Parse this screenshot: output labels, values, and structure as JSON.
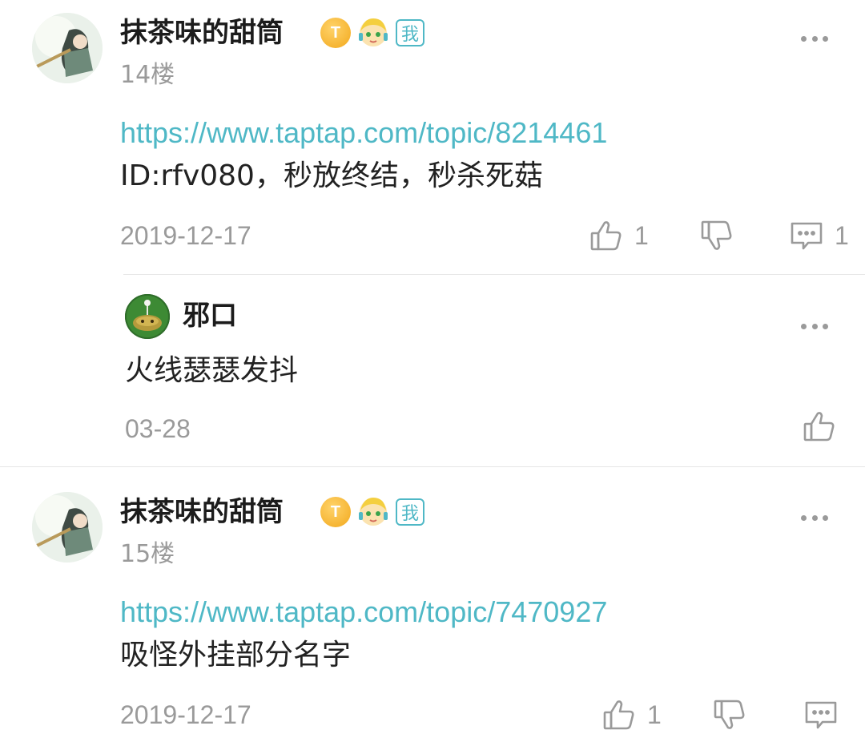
{
  "posts": [
    {
      "username": "抹茶味的甜筒",
      "level_badge": "T",
      "me_badge": "我",
      "floor": "14楼",
      "link": "https://www.taptap.com/topic/8214461",
      "text": "ID:rfv080，秒放终结，秒杀死菇",
      "date": "2019-12-17",
      "likes": "1",
      "comments": "1",
      "icons": [
        "more-icon",
        "thumbs-up-icon",
        "thumbs-down-icon",
        "comment-icon"
      ]
    },
    {
      "username": "抹茶味的甜筒",
      "level_badge": "T",
      "me_badge": "我",
      "floor": "15楼",
      "link": "https://www.taptap.com/topic/7470927",
      "text": "吸怪外挂部分名字",
      "date": "2019-12-17",
      "likes": "1",
      "comments": ""
    }
  ],
  "reply": {
    "username": "邪口",
    "text": "火线瑟瑟发抖",
    "date": "03-28"
  },
  "colors": {
    "accent": "#4fb8c6",
    "muted": "#9a9a9a",
    "text": "#222222"
  }
}
